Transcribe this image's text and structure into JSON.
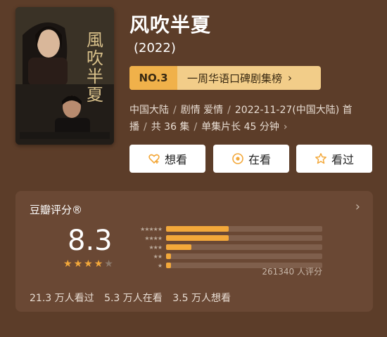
{
  "poster": {
    "title_art": "風吹半夏"
  },
  "title": "风吹半夏",
  "year": "(2022)",
  "ranking": {
    "number": "NO.3",
    "list_name": "一周华语口碑剧集榜",
    "chevron": "chevron-right-icon"
  },
  "meta": {
    "region": "中国大陆",
    "genres": "剧情 爱情",
    "release": "2022-11-27(中国大陆) 首",
    "line2_prefix": "播",
    "episodes": "共 36 集",
    "duration": "单集片长 45 分钟",
    "chevron": "chevron-right-icon"
  },
  "actions": [
    {
      "label": "想看",
      "icon": "heart-plus-icon"
    },
    {
      "label": "在看",
      "icon": "target-circle-icon"
    },
    {
      "label": "看过",
      "icon": "star-outline-icon"
    }
  ],
  "rating": {
    "header": "豆瓣评分®",
    "score": "8.3",
    "stars_filled": 4,
    "stars_total": 5,
    "count_text": "261340 人评分",
    "distribution": [
      {
        "stars": "★★★★★",
        "share": 0.4
      },
      {
        "stars": "★★★★",
        "share": 0.4
      },
      {
        "stars": "★★★",
        "share": 0.16
      },
      {
        "stars": "★★",
        "share": 0.03
      },
      {
        "stars": "★",
        "share": 0.03
      }
    ],
    "stats": [
      "21.3 万人看过",
      "5.3 万人在看",
      "3.5 万人想看"
    ]
  },
  "colors": {
    "background": "#5c3d29",
    "card": "#6a4834",
    "rank_badge": "#f0b14a",
    "rank_bar": "#f2cd89",
    "accent": "#f3a83a"
  }
}
